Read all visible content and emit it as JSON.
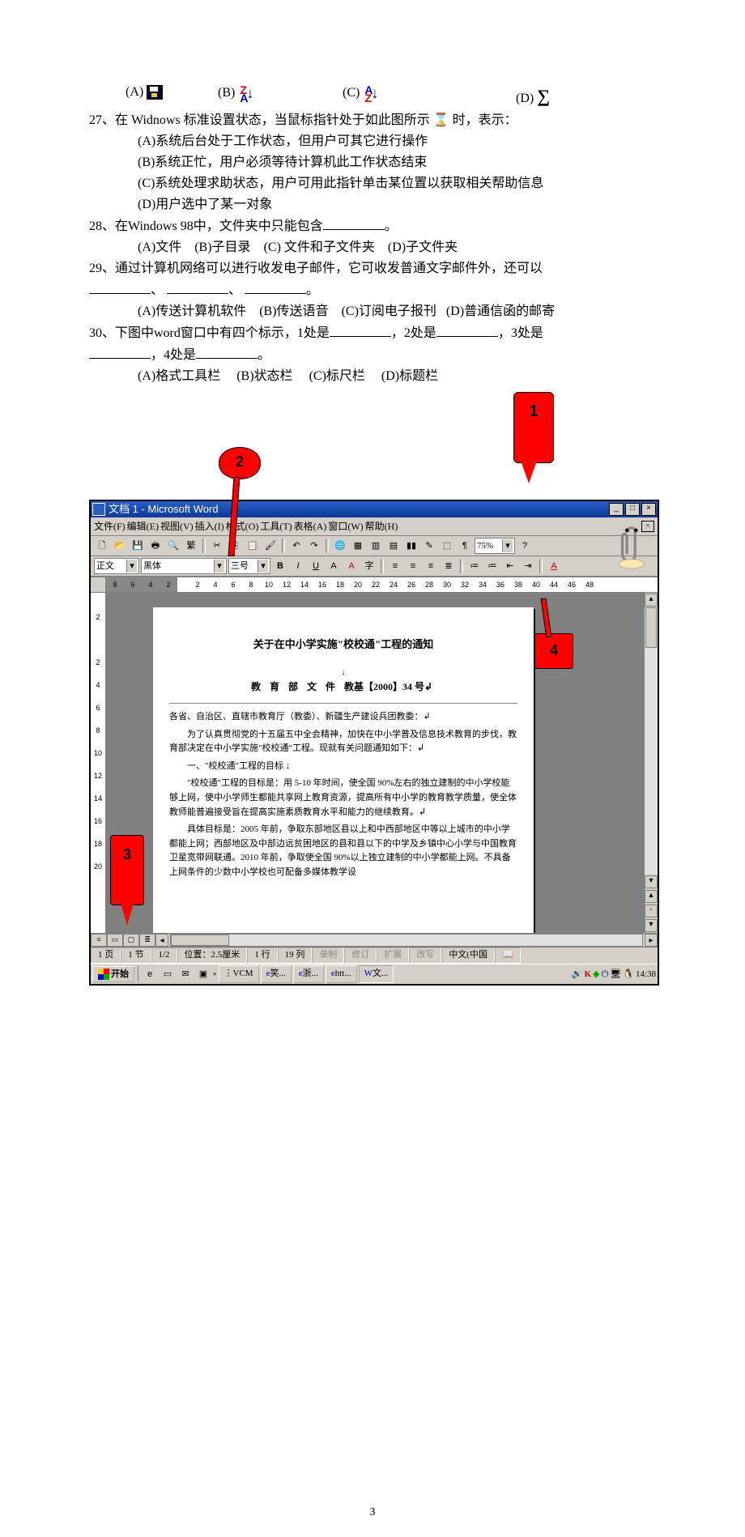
{
  "options_top": {
    "a_label": "(A)",
    "b_label": "(B)",
    "c_label": "(C)",
    "d_label": "(D)",
    "d_symbol": "∑"
  },
  "q27": {
    "stem": "27、在 Widnows 标准设置状态，当鼠标指针处于如此图所示 ",
    "stem_tail": " 时，表示：",
    "opt_a": "(A)系统后台处于工作状态，但用户可其它进行操作",
    "opt_b": "(B)系统正忙，用户必须等待计算机此工作状态结束",
    "opt_c": "(C)系统处理求助状态，用户可用此指针单击某位置以获取相关帮助信息",
    "opt_d": "(D)用户选中了某一对象"
  },
  "q28": {
    "stem_a": "28、在Windows 98中，文件夹中只能包含",
    "stem_b": "。",
    "opt_a": "(A)文件",
    "opt_b": "(B)子目录",
    "opt_c": "(C) 文件和子文件夹",
    "opt_d": "(D)子文件夹"
  },
  "q29": {
    "stem": "29、通过计算机网络可以进行收发电子邮件，它可收发普通文字邮件外，还可以",
    "blanks_line_end": "。",
    "opt_a": "(A)传送计算机软件",
    "opt_b": "(B)传送语音",
    "opt_c": "(C)订阅电子报刊",
    "opt_d": "(D)普通信函的邮寄"
  },
  "q30": {
    "stem_a": "30、下图中word窗口中有四个标示，1处是",
    "stem_b": "，2处是",
    "stem_c": "，3处是",
    "line2_a": "",
    "line2_b": "，4处是",
    "line2_c": "。",
    "opt_a": "(A)格式工具栏",
    "opt_b": "(B)状态栏",
    "opt_c": "(C)标尺栏",
    "opt_d": "(D)标题栏"
  },
  "callouts": {
    "c1": "1",
    "c2": "2",
    "c3": "3",
    "c4": "4"
  },
  "word": {
    "title": "文档 1 - Microsoft Word",
    "menus": [
      "文件(F)",
      "编辑(E)",
      "视图(V)",
      "插入(I)",
      "格式(O)",
      "工具(T)",
      "表格(A)",
      "窗口(W)",
      "帮助(H)"
    ],
    "zoom": "75%",
    "style": "正文",
    "font": "黑体",
    "size": "三号",
    "ruler_dark": [
      "8",
      "6",
      "4",
      "2"
    ],
    "ruler_light": [
      "2",
      "4",
      "6",
      "8",
      "10",
      "12",
      "14",
      "16",
      "18",
      "20",
      "22",
      "24",
      "26",
      "28",
      "30",
      "32",
      "34",
      "36",
      "38",
      "40",
      "",
      "44",
      "46",
      "48"
    ],
    "v_ruler": [
      "2",
      "",
      "2",
      "4",
      "6",
      "8",
      "10",
      "12",
      "14",
      "16",
      "18",
      "20"
    ],
    "doc": {
      "title": "关于在中小学实施\"校校通\"工程的通知",
      "sub_pre": "教 育 部 文 件 ",
      "sub_no": "教基【2000】34 号",
      "p1": "各省、自治区、直辖市教育厅（教委）、新疆生产建设兵团教委：↲",
      "p2": "为了认真贯彻党的十五届五中全会精神，加快在中小学普及信息技术教育的步伐，教育部决定在中小学实施\"校校通\"工程。现就有关问题通知如下：↲",
      "h1": "一、\"校校通\"工程的目标 ↓",
      "p3": "\"校校通\"工程的目标是：用 5-10 年时间，使全国 90%左右的独立建制的中小学校能够上网，使中小学师生都能共享网上教育资源，提高所有中小学的教育教学质量，使全体教师能普遍接受旨在提高实施素质教育水平和能力的继续教育。↲",
      "p4": "具体目标是：2005 年前，争取东部地区县以上和中西部地区中等以上城市的中小学都能上网；西部地区及中部边远贫困地区的县和县以下的中学及乡镇中心小学与中国教育卫星宽带网联通。2010 年前，争取使全国 90%以上独立建制的中小学都能上网。不具备上网条件的少数中小学校也可配备多媒体教学设"
    },
    "status": {
      "page": "1 页",
      "sec": "1 节",
      "pages": "1/2",
      "position": "位置：2.5厘米",
      "line": "1 行",
      "col": "19 列",
      "g1": "录制",
      "g2": "修订",
      "g3": "扩展",
      "g4": "改写",
      "lang": "中文(中国"
    },
    "taskbar": {
      "start": "开始",
      "items": [
        "⋮VCM",
        "笑...",
        "浙...",
        "htt...",
        "文..."
      ],
      "time": "14:38"
    }
  },
  "page_number": "3"
}
